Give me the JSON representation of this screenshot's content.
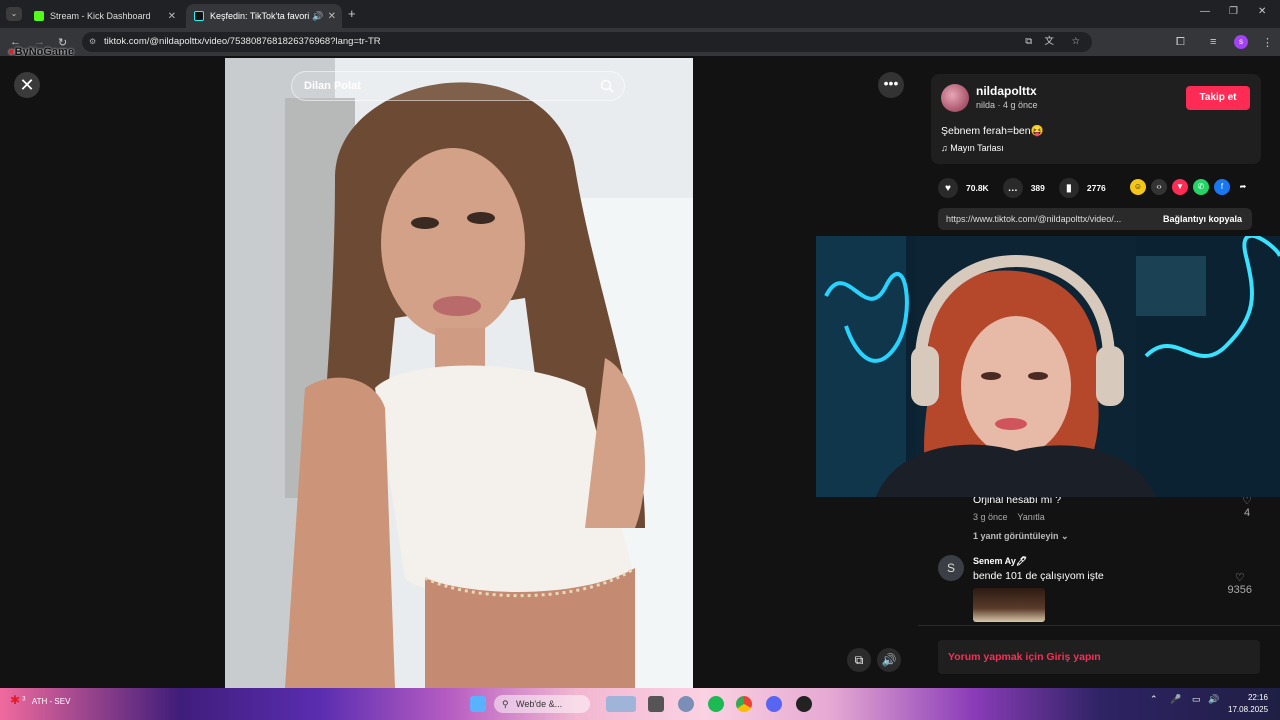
{
  "browser": {
    "tabs": [
      {
        "label": "Stream - Kick Dashboard"
      },
      {
        "label": "Keşfedin: TikTok'ta favori vi"
      }
    ],
    "url": "tiktok.com/@nildapolttx/video/7538087681826376968?lang=tr-TR",
    "overlay_logo": "ByNoGame"
  },
  "stage": {
    "search_value": "Dilan Polat"
  },
  "author": {
    "username": "nildapolttx",
    "subline": "nilda · 4 g önce",
    "follow_label": "Takip et",
    "description": "Şebnem ferah=ben😝",
    "music": "Mayın Tarlası"
  },
  "stats": {
    "likes": "70.8K",
    "comments": "389",
    "saves": "2776"
  },
  "share": {
    "link": "https://www.tiktok.com/@nildapolttx/video/...",
    "copy_label": "Bağlantıyı kopyala"
  },
  "comments": [
    {
      "text": "Orjinal hesabı mı ?",
      "time": "3 g önce",
      "reply_label": "Yanıtla",
      "likes": "4",
      "replies": "1 yanıt görüntüleyin"
    },
    {
      "avatar_letter": "S",
      "user": "Senem Ay🖊",
      "text": "bende 101 de çalışıyom işte",
      "likes": "9356"
    }
  ],
  "login_prompt": "Yorum yapmak için Giriş yapın",
  "taskbar": {
    "weather": "ATH - SEV",
    "search_label": "Web'de &...",
    "time": "22:16",
    "date": "17.08.2025",
    "badge": "3"
  }
}
